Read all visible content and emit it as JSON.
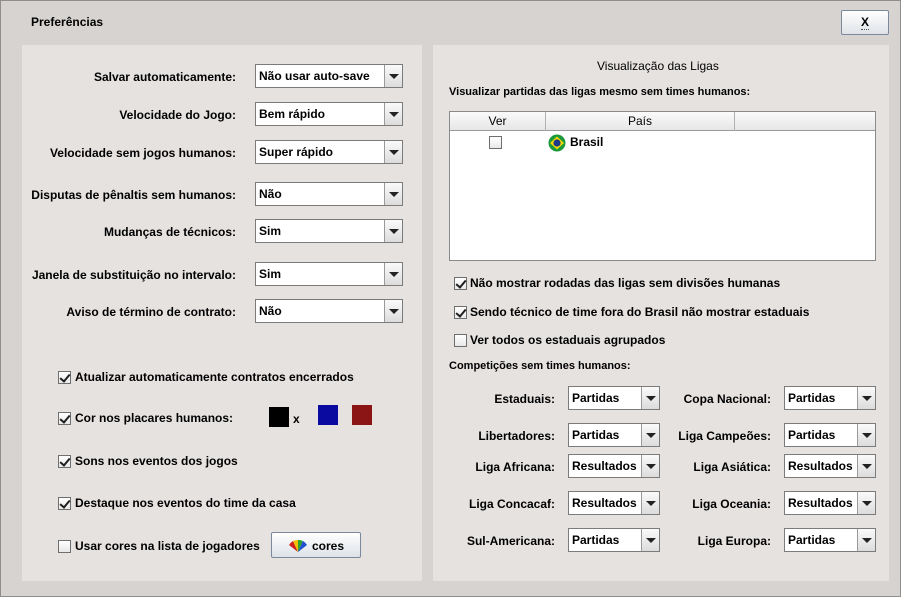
{
  "window": {
    "title": "Preferências",
    "close_label": "X"
  },
  "left": {
    "settings": [
      {
        "label": "Salvar automaticamente:",
        "value": "Não usar auto-save"
      },
      {
        "label": "Velocidade do Jogo:",
        "value": "Bem rápido"
      },
      {
        "label": "Velocidade sem jogos humanos:",
        "value": "Super rápido"
      },
      {
        "label": "Disputas de pênaltis sem humanos:",
        "value": "Não"
      },
      {
        "label": "Mudanças de técnicos:",
        "value": "Sim"
      },
      {
        "label": "Janela de substituição no intervalo:",
        "value": "Sim"
      },
      {
        "label": "Aviso de término de contrato:",
        "value": "Não"
      }
    ],
    "checks": [
      {
        "label": "Atualizar automaticamente contratos encerrados",
        "checked": true
      },
      {
        "label": "Cor nos placares humanos:",
        "checked": true
      },
      {
        "label": "Sons nos eventos dos jogos",
        "checked": true
      },
      {
        "label": "Destaque nos eventos do time da casa",
        "checked": true
      },
      {
        "label": "Usar cores na lista de jogadores",
        "checked": false
      }
    ],
    "colors": {
      "swatch1": "#000000",
      "separator": "x",
      "swatch2": "#0a0aa0",
      "swatch3": "#8b1414"
    },
    "cores_button": "cores"
  },
  "right": {
    "heading": "Visualização das Ligas",
    "subheading": "Visualizar partidas das ligas mesmo sem times humanos:",
    "table": {
      "columns": [
        "Ver",
        "País",
        ""
      ],
      "rows": [
        {
          "ver": false,
          "pais": "Brasil"
        }
      ]
    },
    "options": [
      {
        "label": "Não mostrar rodadas das ligas sem divisões humanas",
        "checked": true
      },
      {
        "label": "Sendo técnico de time fora do Brasil não mostrar estaduais",
        "checked": true
      },
      {
        "label": "Ver todos os estaduais agrupados",
        "checked": false
      }
    ],
    "competitions_heading": "Competições sem times humanos:",
    "competitions": [
      {
        "label": "Estaduais:",
        "value": "Partidas"
      },
      {
        "label": "Copa Nacional:",
        "value": "Partidas"
      },
      {
        "label": "Libertadores:",
        "value": "Partidas"
      },
      {
        "label": "Liga Campeões:",
        "value": "Partidas"
      },
      {
        "label": "Liga Africana:",
        "value": "Resultados"
      },
      {
        "label": "Liga Asiática:",
        "value": "Resultados"
      },
      {
        "label": "Liga Concacaf:",
        "value": "Resultados"
      },
      {
        "label": "Liga Oceania:",
        "value": "Resultados"
      },
      {
        "label": "Sul-Americana:",
        "value": "Partidas"
      },
      {
        "label": "Liga Europa:",
        "value": "Partidas"
      }
    ]
  }
}
